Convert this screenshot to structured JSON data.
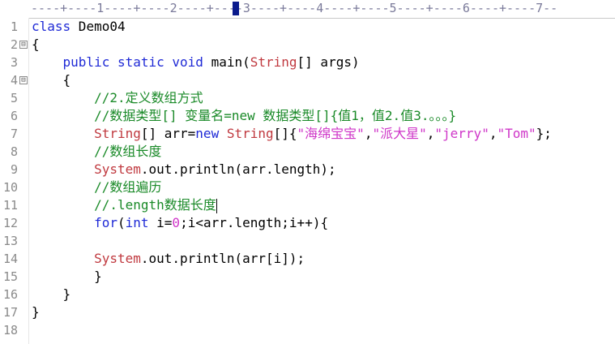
{
  "ruler": {
    "text": "----+----1----+----2----+----3----+----4----+----5----+----6----+----7--"
  },
  "lines": [
    {
      "n": "1",
      "code": "class Demo04"
    },
    {
      "n": "2",
      "code": "{"
    },
    {
      "n": "3",
      "code": "    public static void main(String[] args)"
    },
    {
      "n": "4",
      "code": "    {"
    },
    {
      "n": "5",
      "code": "        //2.定义数组方式"
    },
    {
      "n": "6",
      "code": "        //数据类型[] 变量名=new 数据类型[]{值1，值2.值3.。。。}"
    },
    {
      "n": "7",
      "code": "        String[] arr=new String[]{\"海绵宝宝\",\"派大星\",\"jerry\",\"Tom\"};"
    },
    {
      "n": "8",
      "code": "        //数组长度"
    },
    {
      "n": "9",
      "code": "        System.out.println(arr.length);"
    },
    {
      "n": "10",
      "code": "        //数组遍历"
    },
    {
      "n": "11",
      "code": "        //.length数据长度"
    },
    {
      "n": "12",
      "code": "        for(int i=0;i<arr.length;i++){"
    },
    {
      "n": "13",
      "code": ""
    },
    {
      "n": "14",
      "code": "        System.out.println(arr[i]);"
    },
    {
      "n": "15",
      "code": "        }"
    },
    {
      "n": "16",
      "code": "    }"
    },
    {
      "n": "17",
      "code": "}"
    },
    {
      "n": "18",
      "code": ""
    }
  ],
  "fold_marker": "⊟",
  "colors": {
    "keyword": "#1f2ad6",
    "type": "#c0393f",
    "comment": "#1a8a28",
    "string": "#cf36c8",
    "line_number": "#8a8a8a"
  }
}
